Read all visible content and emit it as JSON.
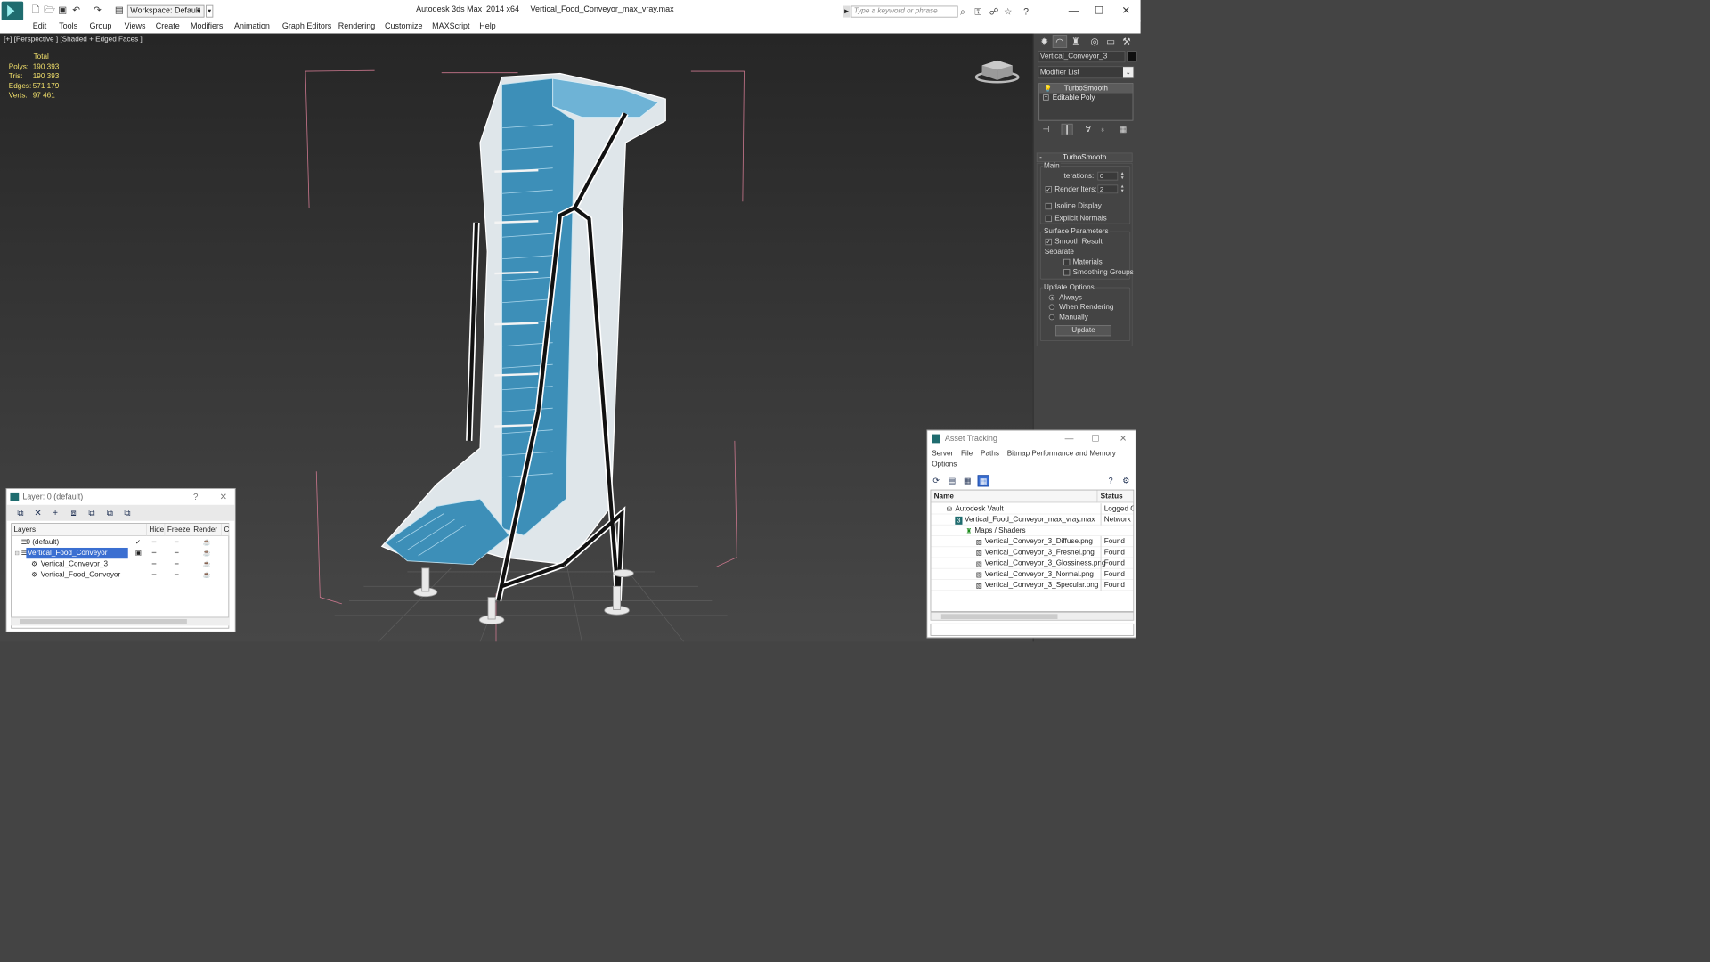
{
  "titlebar": {
    "workspace": "Workspace: Default",
    "title": "Autodesk 3ds Max  2014 x64     Vertical_Food_Conveyor_max_vray.max",
    "search_placeholder": "Type a keyword or phrase"
  },
  "menu": [
    "Edit",
    "Tools",
    "Group",
    "Views",
    "Create",
    "Modifiers",
    "Animation",
    "Graph Editors",
    "Rendering",
    "Customize",
    "MAXScript",
    "Help"
  ],
  "viewport": {
    "label": "[+] [Perspective ] [Shaded + Edged Faces ]",
    "stats": {
      "total_label": "Total",
      "rows": [
        {
          "label": "Polys:",
          "value": "190 393"
        },
        {
          "label": "Tris:",
          "value": "190 393"
        },
        {
          "label": "Edges:",
          "value": "571 179"
        },
        {
          "label": "Verts:",
          "value": "97 461"
        }
      ]
    }
  },
  "command_panel": {
    "object_name": "Vertical_Conveyor_3",
    "modifier_list": "Modifier List",
    "stack": [
      "TurboSmooth",
      "Editable Poly"
    ],
    "rollout_title": "TurboSmooth",
    "main_group": "Main",
    "iterations_label": "Iterations:",
    "iterations_value": "0",
    "render_iters_label": "Render Iters:",
    "render_iters_value": "2",
    "isoline_display": "Isoline Display",
    "explicit_normals": "Explicit Normals",
    "surface_params": "Surface Parameters",
    "smooth_result": "Smooth Result",
    "separate": "Separate",
    "materials": "Materials",
    "smoothing_groups": "Smoothing Groups",
    "update_options": "Update Options",
    "always": "Always",
    "when_rendering": "When Rendering",
    "manually": "Manually",
    "update_button": "Update"
  },
  "layer_window": {
    "title": "Layer: 0 (default)",
    "help": "?",
    "columns": [
      "Layers",
      "Hide",
      "Freeze",
      "Render",
      "C"
    ],
    "rows": [
      {
        "name": "0 (default)",
        "indent": 0
      },
      {
        "name": "Vertical_Food_Conveyor",
        "indent": 0
      },
      {
        "name": "Vertical_Conveyor_3",
        "indent": 1
      },
      {
        "name": "Vertical_Food_Conveyor",
        "indent": 1
      }
    ]
  },
  "asset_window": {
    "title": "Asset Tracking",
    "menu": [
      "Server",
      "File",
      "Paths",
      "Bitmap Performance and Memory",
      "Options"
    ],
    "columns": [
      "Name",
      "Status"
    ],
    "rows": [
      {
        "name": "Autodesk Vault",
        "status": "Logged Ou"
      },
      {
        "name": "Vertical_Food_Conveyor_max_vray.max",
        "status": "Network P"
      },
      {
        "name": "Maps / Shaders",
        "status": ""
      },
      {
        "name": "Vertical_Conveyor_3_Diffuse.png",
        "status": "Found"
      },
      {
        "name": "Vertical_Conveyor_3_Fresnel.png",
        "status": "Found"
      },
      {
        "name": "Vertical_Conveyor_3_Glossiness.png",
        "status": "Found"
      },
      {
        "name": "Vertical_Conveyor_3_Normal.png",
        "status": "Found"
      },
      {
        "name": "Vertical_Conveyor_3_Specular.png",
        "status": "Found"
      }
    ]
  },
  "colors": {
    "stats_yellow": "#f2e06b",
    "selection_blue": "#3b6fd1",
    "conveyor_blue": "#3d8fb8",
    "bbox_pink": "#c8768c"
  }
}
